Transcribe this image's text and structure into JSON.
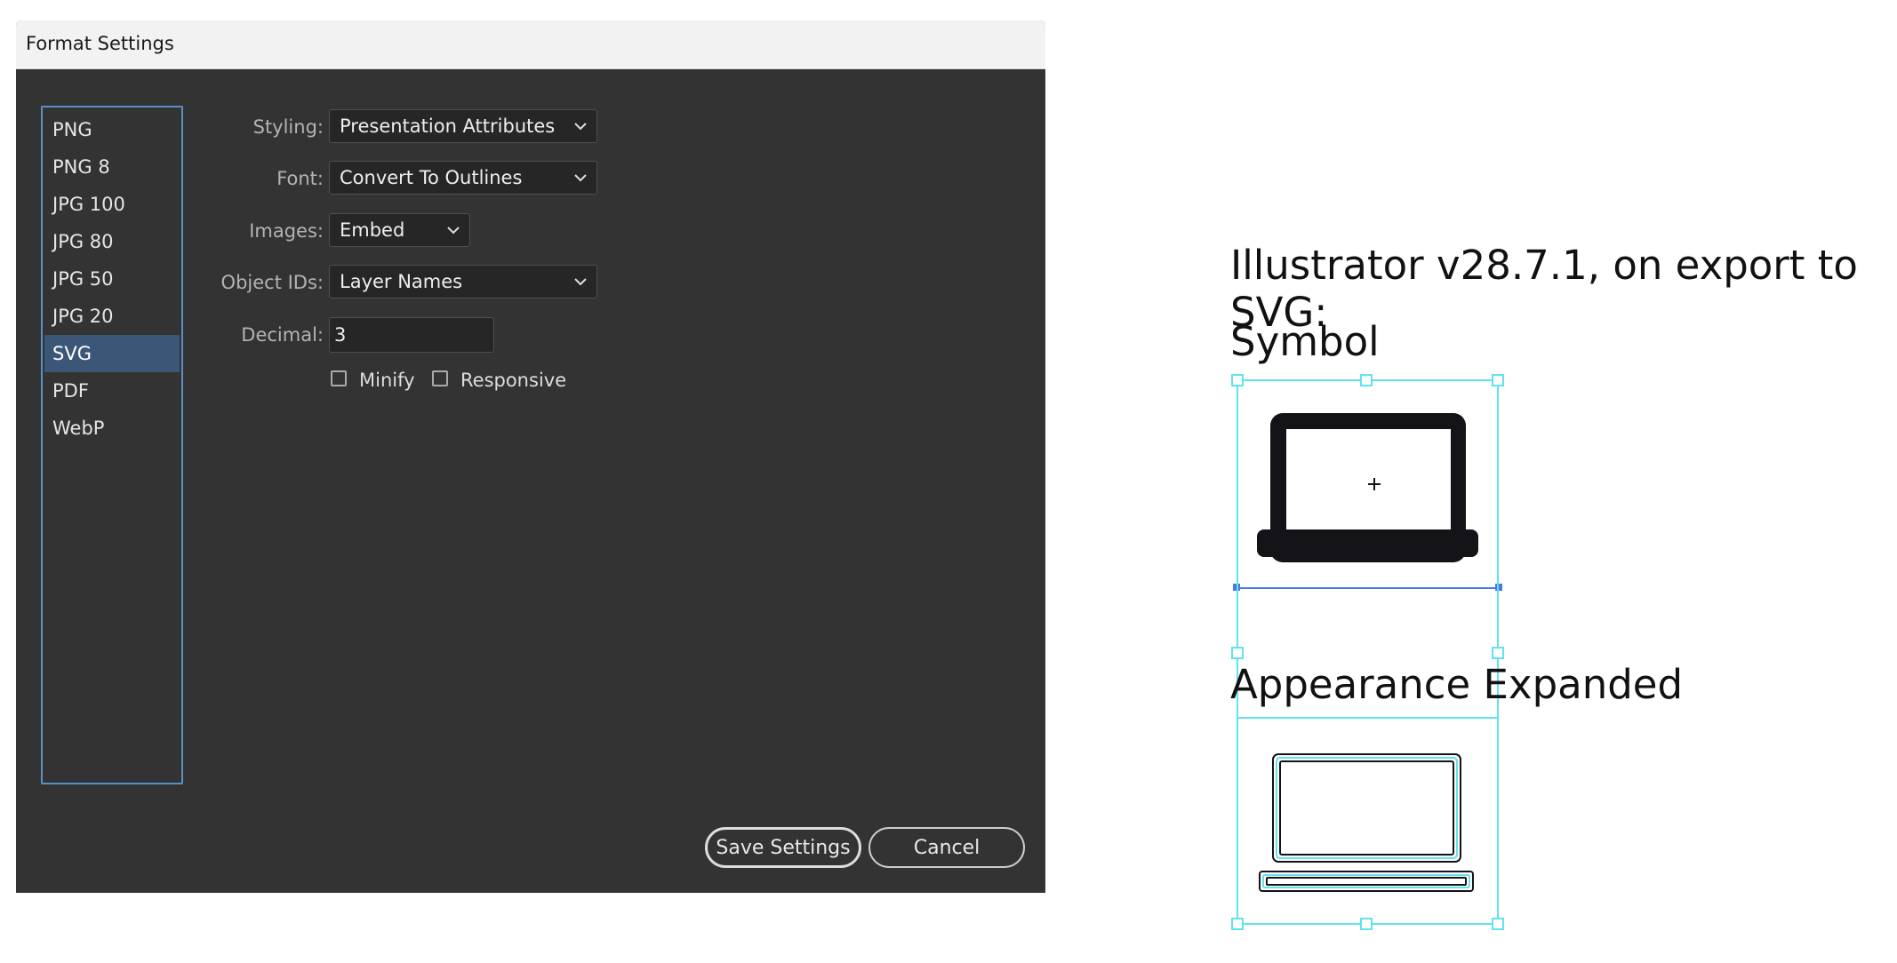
{
  "dialog": {
    "title": "Format Settings",
    "formats": [
      "PNG",
      "PNG 8",
      "JPG 100",
      "JPG 80",
      "JPG 50",
      "JPG 20",
      "SVG",
      "PDF",
      "WebP"
    ],
    "selected_format": "SVG",
    "fields": {
      "styling": {
        "label": "Styling:",
        "value": "Presentation Attributes"
      },
      "font": {
        "label": "Font:",
        "value": "Convert To Outlines"
      },
      "images": {
        "label": "Images:",
        "value": "Embed"
      },
      "object_ids": {
        "label": "Object IDs:",
        "value": "Layer Names"
      },
      "decimal": {
        "label": "Decimal:",
        "value": "3"
      }
    },
    "options": {
      "minify": {
        "label": "Minify",
        "checked": false
      },
      "responsive": {
        "label": "Responsive",
        "checked": false
      }
    },
    "buttons": {
      "save": "Save Settings",
      "cancel": "Cancel"
    }
  },
  "annotation": {
    "heading": "Illustrator v28.7.1, on export to SVG:",
    "symbol_label": "Symbol",
    "expanded_label": "Appearance Expanded"
  },
  "icons": {
    "chevron": "chevron-down-icon",
    "symbol_art": "laptop-icon",
    "expanded_art": "laptop-outline-icon",
    "selection_color": "#5fe3ec",
    "art_color": "#131318"
  }
}
